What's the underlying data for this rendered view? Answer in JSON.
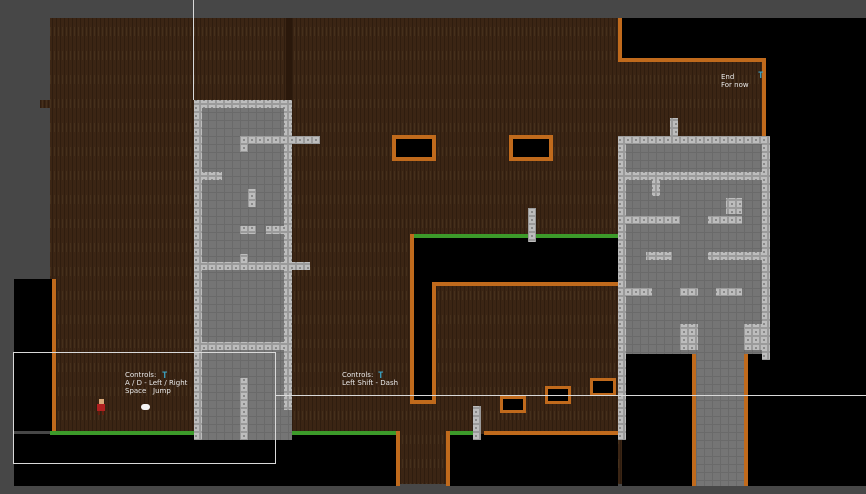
{
  "colors": {
    "background": "#474747",
    "wood": "#3b2514",
    "void": "#000000",
    "dirt_edge": "#c06a1c",
    "grass": "#3c9a2a",
    "stone": "#747474",
    "stone_border": "#b4b4b4",
    "sign": "#3aa0c0",
    "frame": "#d9d9d9"
  },
  "tutorial_signs": [
    {
      "icon": "signpost-icon",
      "title": "Controls:",
      "line1": "A / D - Left / Right",
      "line2": "Space   Jump"
    },
    {
      "icon": "signpost-icon",
      "title": "Controls:",
      "line1": "Left Shift - Dash",
      "line2": ""
    }
  ],
  "end_sign": {
    "icon": "signpost-icon",
    "line1": "End",
    "line2": "For now"
  },
  "player": {
    "icon": "player-character-icon"
  },
  "pickup": {
    "icon": "cloud-pickup-icon"
  }
}
